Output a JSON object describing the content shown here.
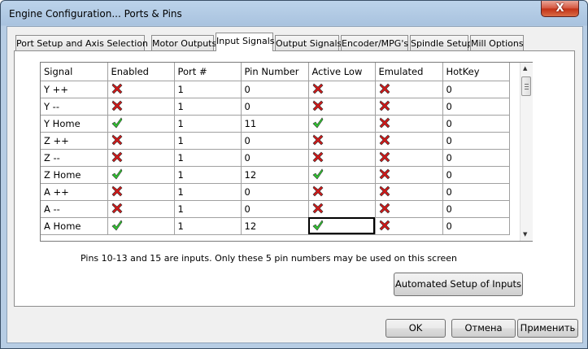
{
  "window": {
    "title": "Engine Configuration... Ports & Pins",
    "close_label": "X"
  },
  "tabs": [
    {
      "label": "Port Setup and Axis Selection",
      "active": false
    },
    {
      "label": "Motor Outputs",
      "active": false
    },
    {
      "label": "Input Signals",
      "active": true
    },
    {
      "label": "Output Signals",
      "active": false
    },
    {
      "label": "Encoder/MPG's",
      "active": false
    },
    {
      "label": "Spindle Setup",
      "active": false
    },
    {
      "label": "Mill Options",
      "active": false
    }
  ],
  "table": {
    "columns": [
      "Signal",
      "Enabled",
      "Port #",
      "Pin Number",
      "Active Low",
      "Emulated",
      "HotKey"
    ],
    "rows": [
      {
        "signal": "Y ++",
        "enabled": false,
        "port": "1",
        "pin": "0",
        "active_low": false,
        "emulated": false,
        "hotkey": "0"
      },
      {
        "signal": "Y --",
        "enabled": false,
        "port": "1",
        "pin": "0",
        "active_low": false,
        "emulated": false,
        "hotkey": "0"
      },
      {
        "signal": "Y Home",
        "enabled": true,
        "port": "1",
        "pin": "11",
        "active_low": true,
        "emulated": false,
        "hotkey": "0"
      },
      {
        "signal": "Z ++",
        "enabled": false,
        "port": "1",
        "pin": "0",
        "active_low": false,
        "emulated": false,
        "hotkey": "0"
      },
      {
        "signal": "Z --",
        "enabled": false,
        "port": "1",
        "pin": "0",
        "active_low": false,
        "emulated": false,
        "hotkey": "0"
      },
      {
        "signal": "Z Home",
        "enabled": true,
        "port": "1",
        "pin": "12",
        "active_low": true,
        "emulated": false,
        "hotkey": "0"
      },
      {
        "signal": "A ++",
        "enabled": false,
        "port": "1",
        "pin": "0",
        "active_low": false,
        "emulated": false,
        "hotkey": "0"
      },
      {
        "signal": "A --",
        "enabled": false,
        "port": "1",
        "pin": "0",
        "active_low": false,
        "emulated": false,
        "hotkey": "0"
      },
      {
        "signal": "A Home",
        "enabled": true,
        "port": "1",
        "pin": "12",
        "active_low": true,
        "emulated": false,
        "hotkey": "0"
      }
    ]
  },
  "info_text": "Pins 10-13 and 15 are inputs. Only these 5 pin numbers may be used on this screen",
  "buttons": {
    "auto_setup": "Automated Setup of Inputs",
    "ok": "OK",
    "cancel": "Отмена",
    "apply": "Применить"
  },
  "icons": {
    "enabled_true": "green-check-icon",
    "enabled_false": "red-x-icon",
    "color_true": "#2fc42f",
    "color_false": "#d01818"
  }
}
